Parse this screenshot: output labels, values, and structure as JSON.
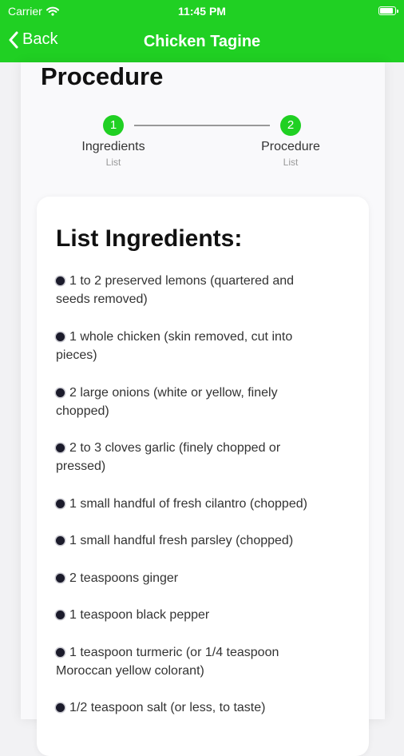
{
  "status": {
    "carrier": "Carrier",
    "time": "11:45 PM",
    "battery_level": 0.95
  },
  "nav": {
    "back_label": "Back",
    "title": "Chicken Tagine"
  },
  "page": {
    "heading": "Procedure"
  },
  "stepper": {
    "steps": [
      {
        "number": "1",
        "title": "Ingredients",
        "subtitle": "List"
      },
      {
        "number": "2",
        "title": "Procedure",
        "subtitle": "List"
      }
    ]
  },
  "card": {
    "title": "List Ingredients:",
    "ingredients": [
      "1 to 2 preserved lemons (quartered and seeds removed)",
      "1 whole chicken (skin removed, cut into pieces)",
      "2 large onions (white or yellow, finely chopped)",
      "2 to 3 cloves garlic (finely chopped or pressed)",
      "1 small handful of fresh cilantro (chopped)",
      "1 small handful fresh parsley (chopped)",
      "2 teaspoons ginger",
      "1 teaspoon black pepper",
      "1 teaspoon turmeric (or 1/4 teaspoon Moroccan yellow colorant)",
      "1/2 teaspoon salt (or less, to taste)"
    ]
  },
  "colors": {
    "accent": "#20d023",
    "bullet": "#1b1b2b"
  },
  "icons": {
    "wifi": "wifi-icon",
    "battery": "battery-icon",
    "back": "chevron-left-icon"
  }
}
